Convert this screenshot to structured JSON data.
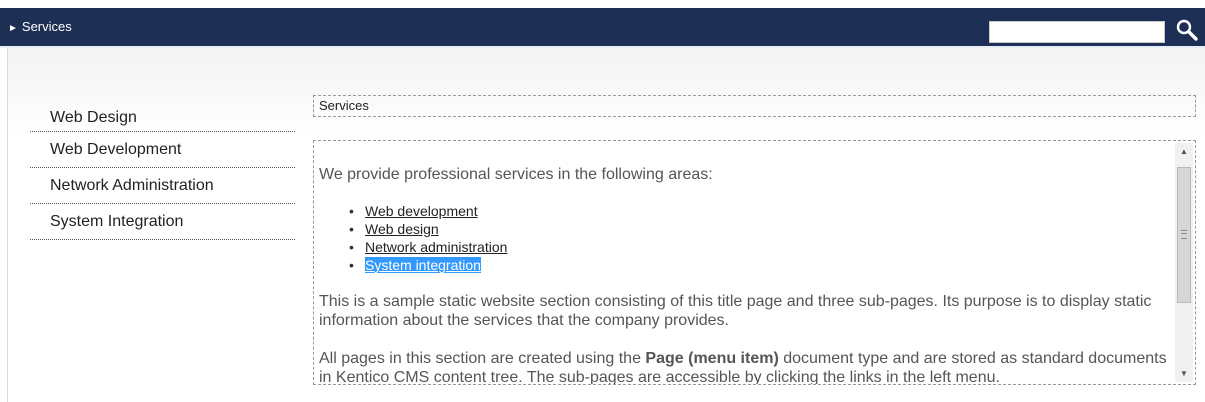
{
  "header": {
    "breadcrumb_arrow": "►",
    "breadcrumb": "Services",
    "search": {
      "value": "",
      "placeholder": ""
    },
    "search_icon": "search-icon",
    "background_color": "#1d2f55"
  },
  "sidebar": {
    "items": [
      {
        "label": "Web Design"
      },
      {
        "label": "Web Development"
      },
      {
        "label": "Network Administration"
      },
      {
        "label": "System Integration"
      }
    ]
  },
  "main": {
    "title": "Services",
    "intro": "We provide professional services in the following areas:",
    "services": [
      {
        "label": "Web development"
      },
      {
        "label": "Web design"
      },
      {
        "label": "Network administration"
      },
      {
        "label": "System integration",
        "selected": true
      }
    ],
    "paragraph2": "This is a sample static website section consisting of this title page and three sub-pages. Its purpose is to display static information about the services that the company provides.",
    "paragraph3_start": "All pages in this section are created using the ",
    "paragraph3_bold": "Page (menu item)",
    "paragraph3_end": " document type and are stored as standard documents in Kentico CMS content tree. The sub-pages are accessible by clicking the links in the left menu."
  },
  "colors": {
    "selection": "#3399ff",
    "header": "#1d2f55"
  }
}
